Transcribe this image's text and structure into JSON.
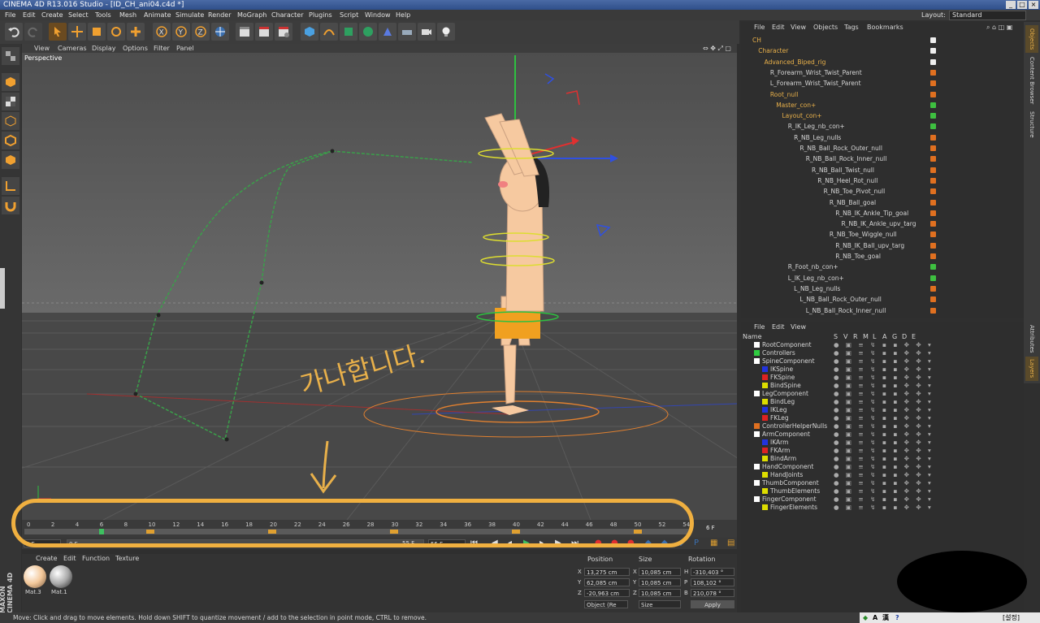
{
  "window": {
    "title": "CINEMA 4D R13.016 Studio - [ID_CH_ani04.c4d *]"
  },
  "menubar": [
    "File",
    "Edit",
    "Create",
    "Select",
    "Tools",
    "Mesh",
    "Animate",
    "Simulate",
    "Render",
    "MoGraph",
    "Character",
    "Plugins",
    "Script",
    "Window",
    "Help"
  ],
  "layout": {
    "label": "Layout:",
    "value": "Standard"
  },
  "viewport": {
    "menu": [
      "View",
      "Cameras",
      "Display",
      "Options",
      "Filter",
      "Panel"
    ],
    "label": "Perspective",
    "annotation_text": "가나합니다."
  },
  "timeline": {
    "ticks": [
      "0",
      "2",
      "4",
      "6",
      "8",
      "10",
      "12",
      "14",
      "16",
      "18",
      "20",
      "22",
      "24",
      "26",
      "28",
      "30",
      "32",
      "34",
      "36",
      "38",
      "40",
      "42",
      "44",
      "46",
      "48",
      "50",
      "52",
      "54"
    ],
    "current_frame_label": "6 F",
    "start_field": "0 F",
    "min_field": "0 F",
    "max_field": "55 F",
    "end_field": "55 F"
  },
  "material_manager": {
    "menu": [
      "Create",
      "Edit",
      "Function",
      "Texture"
    ],
    "materials": [
      "Mat.3",
      "Mat.1"
    ],
    "brand": "MAXON CINEMA 4D"
  },
  "coordinates": {
    "headers": [
      "Position",
      "Size",
      "Rotation"
    ],
    "position": [
      {
        "axis": "X",
        "value": "13,275 cm"
      },
      {
        "axis": "Y",
        "value": "62,085 cm"
      },
      {
        "axis": "Z",
        "value": "-20,963 cm"
      }
    ],
    "size": [
      {
        "axis": "X",
        "value": "10,085 cm"
      },
      {
        "axis": "Y",
        "value": "10,085 cm"
      },
      {
        "axis": "Z",
        "value": "10,085 cm"
      }
    ],
    "rotation": [
      {
        "axis": "H",
        "value": "-310,403 °"
      },
      {
        "axis": "P",
        "value": "108,102 °"
      },
      {
        "axis": "B",
        "value": "210,078 °"
      }
    ],
    "mode": "Object (Re",
    "size_mode": "Size",
    "apply": "Apply"
  },
  "object_manager": {
    "menu": [
      "File",
      "Edit",
      "View",
      "Objects",
      "Tags",
      "Bookmarks"
    ],
    "rows": [
      {
        "label": "CH",
        "color": "#e8b04a"
      },
      {
        "label": "Character",
        "color": "#e8b04a"
      },
      {
        "label": "Advanced_Biped_rig",
        "color": "#e8b04a"
      },
      {
        "label": "R_Forearm_Wrist_Twist_Parent",
        "color": "#d6d6d6"
      },
      {
        "label": "L_Forearm_Wrist_Twist_Parent",
        "color": "#d6d6d6"
      },
      {
        "label": "Root_null",
        "color": "#e8b04a"
      },
      {
        "label": "Master_con+",
        "color": "#e8b04a"
      },
      {
        "label": "Layout_con+",
        "color": "#e8b04a"
      },
      {
        "label": "R_IK_Leg_nb_con+",
        "color": "#d6d6d6"
      },
      {
        "label": "R_NB_Leg_nulls",
        "color": "#d6d6d6"
      },
      {
        "label": "R_NB_Ball_Rock_Outer_null",
        "color": "#d6d6d6"
      },
      {
        "label": "R_NB_Ball_Rock_Inner_null",
        "color": "#d6d6d6"
      },
      {
        "label": "R_NB_Ball_Twist_null",
        "color": "#d6d6d6"
      },
      {
        "label": "R_NB_Heel_Rot_null",
        "color": "#d6d6d6"
      },
      {
        "label": "R_NB_Toe_Pivot_null",
        "color": "#d6d6d6"
      },
      {
        "label": "R_NB_Ball_goal",
        "color": "#d6d6d6"
      },
      {
        "label": "R_NB_IK_Ankle_Tip_goal",
        "color": "#d6d6d6"
      },
      {
        "label": "R_NB_IK_Ankle_upv_targ",
        "color": "#d6d6d6"
      },
      {
        "label": "R_NB_Toe_Wiggle_null",
        "color": "#d6d6d6"
      },
      {
        "label": "R_NB_IK_Ball_upv_targ",
        "color": "#d6d6d6"
      },
      {
        "label": "R_NB_Toe_goal",
        "color": "#d6d6d6"
      },
      {
        "label": "R_Foot_nb_con+",
        "color": "#d6d6d6"
      },
      {
        "label": "L_IK_Leg_nb_con+",
        "color": "#d6d6d6"
      },
      {
        "label": "L_NB_Leg_nulls",
        "color": "#d6d6d6"
      },
      {
        "label": "L_NB_Ball_Rock_Outer_null",
        "color": "#d6d6d6"
      },
      {
        "label": "L_NB_Ball_Rock_Inner_null",
        "color": "#d6d6d6"
      }
    ]
  },
  "layer_manager": {
    "menu": [
      "File",
      "Edit",
      "View"
    ],
    "columns": [
      "Name",
      "S",
      "V",
      "R",
      "M",
      "L",
      "A",
      "G",
      "D",
      "E"
    ],
    "rows": [
      {
        "label": "RootComponent",
        "color": "#ffffff",
        "depth": 0
      },
      {
        "label": "Controllers",
        "color": "#2ecc40",
        "depth": 0
      },
      {
        "label": "SpineComponent",
        "color": "#ffffff",
        "depth": 0
      },
      {
        "label": "IKSpine",
        "color": "#2233dd",
        "depth": 1
      },
      {
        "label": "FKSpine",
        "color": "#dd2222",
        "depth": 1
      },
      {
        "label": "BindSpine",
        "color": "#dddd00",
        "depth": 1
      },
      {
        "label": "LegComponent",
        "color": "#ffffff",
        "depth": 0
      },
      {
        "label": "BindLeg",
        "color": "#dddd00",
        "depth": 1
      },
      {
        "label": "IKLeg",
        "color": "#2233dd",
        "depth": 1
      },
      {
        "label": "FKLeg",
        "color": "#dd2222",
        "depth": 1
      },
      {
        "label": "ControllerHelperNulls",
        "color": "#e07020",
        "depth": 0
      },
      {
        "label": "ArmComponent",
        "color": "#ffffff",
        "depth": 0
      },
      {
        "label": "IKArm",
        "color": "#2233dd",
        "depth": 1
      },
      {
        "label": "FKArm",
        "color": "#dd2222",
        "depth": 1
      },
      {
        "label": "BindArm",
        "color": "#dddd00",
        "depth": 1
      },
      {
        "label": "HandComponent",
        "color": "#ffffff",
        "depth": 0
      },
      {
        "label": "HandJoints",
        "color": "#dddd00",
        "depth": 1
      },
      {
        "label": "ThumbComponent",
        "color": "#ffffff",
        "depth": 0
      },
      {
        "label": "ThumbElements",
        "color": "#dddd00",
        "depth": 1
      },
      {
        "label": "FingerComponent",
        "color": "#ffffff",
        "depth": 0
      },
      {
        "label": "FingerElements",
        "color": "#dddd00",
        "depth": 1
      }
    ]
  },
  "right_tabs": [
    "Objects",
    "Content Browser",
    "Structure",
    "Attributes",
    "Layers"
  ],
  "status": "Move: Click and drag to move elements. Hold down SHIFT to quantize movement / add to the selection in point mode, CTRL to remove.",
  "ime": {
    "a": "A",
    "han": "漢",
    "help": "?",
    "tray": "[설정]"
  },
  "colors": {
    "accent": "#e8b04a",
    "viewport_bg": "#555555",
    "panel_bg": "#2e2e2e",
    "highlight": "#f0b040"
  }
}
